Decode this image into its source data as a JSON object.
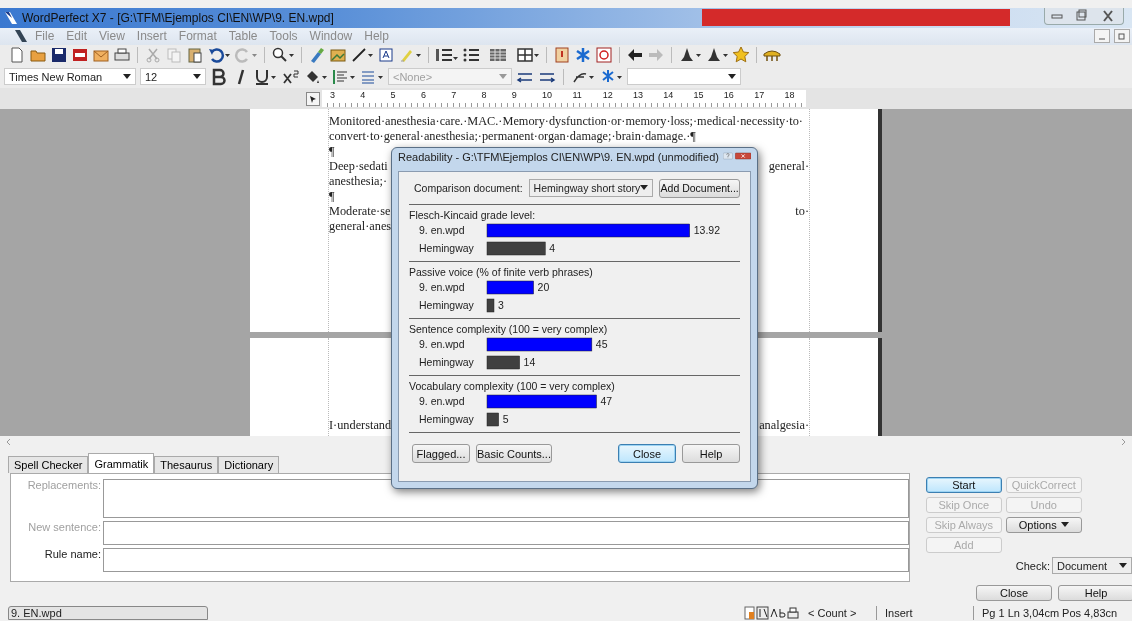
{
  "window": {
    "title": "WordPerfect X7 - [G:\\TFM\\Ejemplos CI\\EN\\WP\\9. EN.wpd]"
  },
  "menu": [
    "File",
    "Edit",
    "View",
    "Insert",
    "Format",
    "Table",
    "Tools",
    "Window",
    "Help"
  ],
  "format_bar": {
    "font": "Times New Roman",
    "size": "12",
    "style": "<None>"
  },
  "ruler": {
    "labels": [
      "3",
      "4",
      "5",
      "6",
      "7",
      "8",
      "9",
      "10",
      "11",
      "12",
      "13",
      "14",
      "15",
      "16",
      "17",
      "18"
    ]
  },
  "document": {
    "pages": [
      {
        "lines": [
          {
            "left": "Monitored·anesthesia·care.·MAC.·Memory·dysfunction·or·memory·loss;·medical·necessity·to·"
          },
          {
            "left": "convert·to·general·anesthesia;·permanent·organ·damage;·brain·damage.·¶"
          },
          {
            "left": "¶"
          },
          {
            "left": "Deep·sedati",
            "right": "general·"
          },
          {
            "left": "anesthesia;·"
          },
          {
            "left": "¶"
          },
          {
            "left": "Moderate·se",
            "right": "to·"
          },
          {
            "left": "general·anes"
          }
        ]
      },
      {
        "lines": [
          {
            "left": "I·understand",
            "right": "analgesia·"
          }
        ]
      }
    ]
  },
  "panel_tabs": [
    {
      "label": "Spell Checker",
      "selected": false
    },
    {
      "label": "Grammatik",
      "selected": true
    },
    {
      "label": "Thesaurus",
      "selected": false
    },
    {
      "label": "Dictionary",
      "selected": false
    }
  ],
  "grammatik": {
    "fields": [
      {
        "label": "Replacements:",
        "disabled": true,
        "kind": "tall"
      },
      {
        "label": "New sentence:",
        "disabled": true,
        "kind": "short"
      },
      {
        "label": "Rule name:",
        "disabled": false,
        "kind": "short"
      }
    ],
    "buttons": [
      {
        "label": "Start",
        "disabled": false,
        "default": true,
        "kind": "plain"
      },
      {
        "label": "QuickCorrect",
        "disabled": true,
        "default": false,
        "kind": "plain"
      },
      {
        "label": "Skip Once",
        "disabled": true,
        "default": false,
        "kind": "plain"
      },
      {
        "label": "Undo",
        "disabled": true,
        "default": false,
        "kind": "plain"
      },
      {
        "label": "Skip Always",
        "disabled": true,
        "default": false,
        "kind": "plain"
      },
      {
        "label": "Options",
        "disabled": false,
        "default": false,
        "kind": "menu"
      },
      {
        "label": "Add",
        "disabled": true,
        "default": false,
        "kind": "plain"
      }
    ],
    "check": {
      "label": "Check:",
      "value": "Document"
    },
    "bottom_buttons": [
      "Close",
      "Help"
    ]
  },
  "status_bar": {
    "file": "9. EN.wpd",
    "count": "< Count >",
    "mode": "Insert",
    "position": "Pg 1 Ln 3,04cm Pos 4,83cn"
  },
  "dialog": {
    "title": "Readability - G:\\TFM\\Ejemplos CI\\EN\\WP\\9. EN.wpd (unmodified)",
    "comparison": {
      "label": "Comparison document:",
      "value": "Hemingway short story"
    },
    "add_button": "Add Document...",
    "sections": [
      {
        "chart_data": {
          "type": "bar",
          "orientation": "horizontal",
          "title": "Flesch-Kincaid grade level:",
          "categories": [
            "9. en.wpd",
            "Hemingway"
          ],
          "values": [
            13.92,
            4
          ],
          "data_labels": true
        }
      },
      {
        "chart_data": {
          "type": "bar",
          "orientation": "horizontal",
          "title": "Passive voice (% of finite verb phrases)",
          "categories": [
            "9. en.wpd",
            "Hemingway"
          ],
          "values": [
            20,
            3
          ],
          "data_labels": true
        }
      },
      {
        "chart_data": {
          "type": "bar",
          "orientation": "horizontal",
          "title": "Sentence complexity (100 = very complex)",
          "categories": [
            "9. en.wpd",
            "Hemingway"
          ],
          "values": [
            45,
            14
          ],
          "data_labels": true
        }
      },
      {
        "chart_data": {
          "type": "bar",
          "orientation": "horizontal",
          "title": "Vocabulary complexity (100 = very complex)",
          "categories": [
            "9. en.wpd",
            "Hemingway"
          ],
          "values": [
            47,
            5
          ],
          "data_labels": true
        }
      }
    ],
    "buttons": [
      {
        "label": "Flagged...",
        "default": false
      },
      {
        "label": "Basic Counts...",
        "default": false
      },
      {
        "label": "Close",
        "default": true
      },
      {
        "label": "Help",
        "default": false
      }
    ]
  }
}
